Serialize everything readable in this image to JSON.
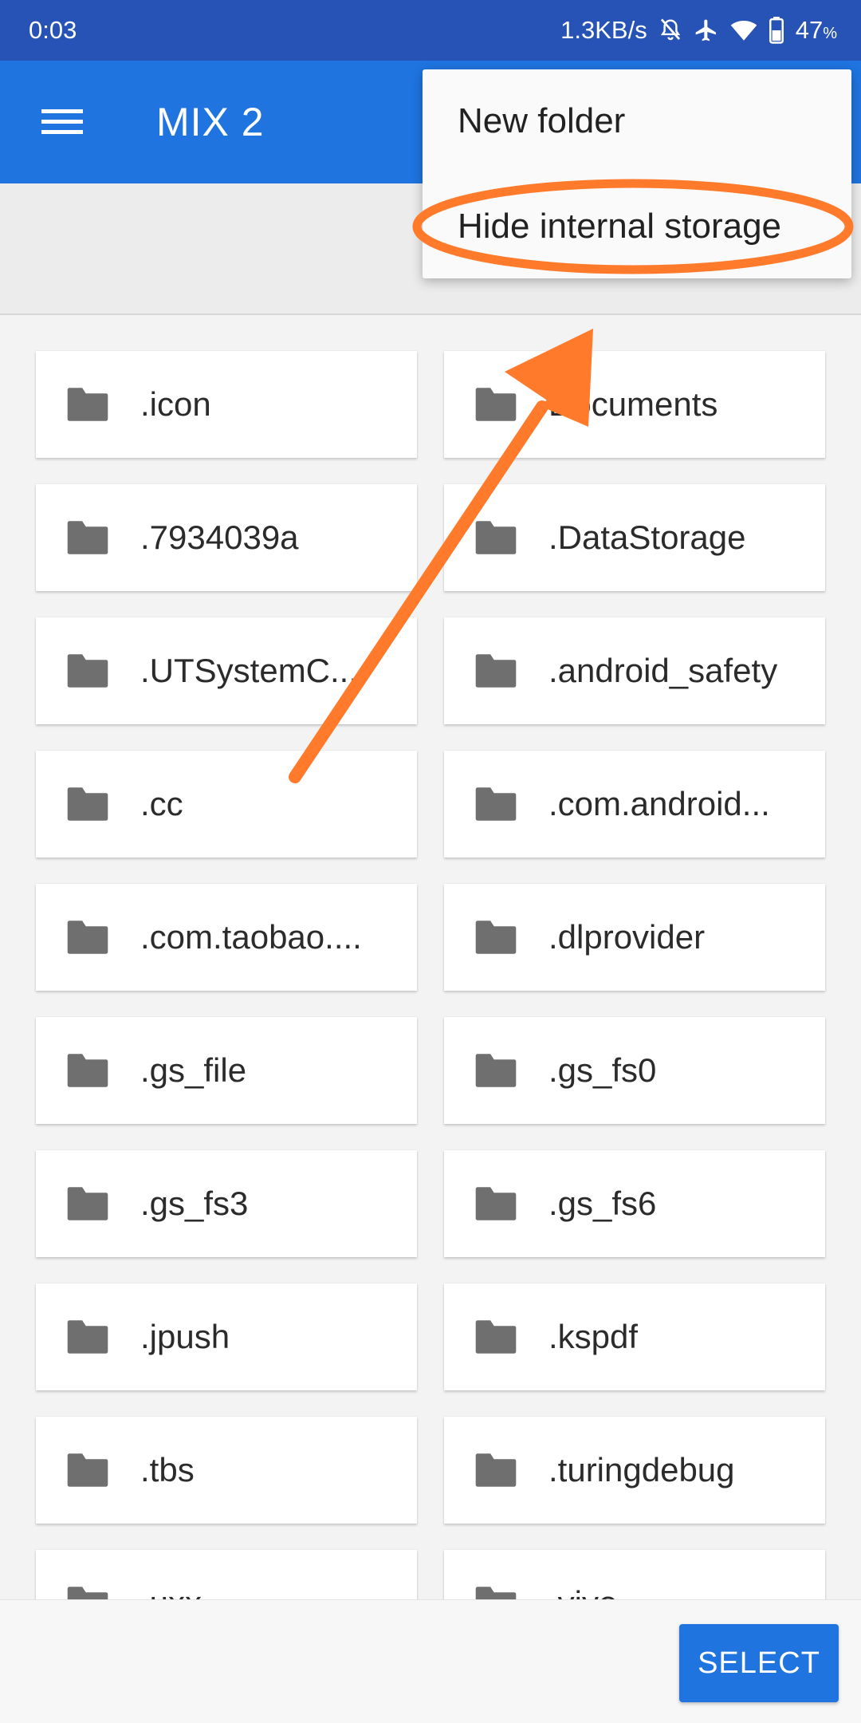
{
  "status_bar": {
    "time": "0:03",
    "net_speed": "1.3KB/s",
    "battery": "47",
    "battery_unit": "%",
    "icons": [
      "bell-off-icon",
      "airplane-icon",
      "wifi-icon",
      "battery-icon"
    ]
  },
  "app_bar": {
    "title": "MIX 2",
    "menu_icon": "hamburger-icon",
    "color": "#1f74e0"
  },
  "overflow_menu": {
    "items": [
      {
        "label": "New folder"
      },
      {
        "label": "Hide internal storage"
      }
    ]
  },
  "folders": [
    {
      "name": ".icon"
    },
    {
      "name": "Documents"
    },
    {
      "name": ".7934039a"
    },
    {
      "name": ".DataStorage"
    },
    {
      "name": ".UTSystemC..."
    },
    {
      "name": ".android_safety"
    },
    {
      "name": ".cc"
    },
    {
      "name": ".com.android..."
    },
    {
      "name": ".com.taobao...."
    },
    {
      "name": ".dlprovider"
    },
    {
      "name": ".gs_file"
    },
    {
      "name": ".gs_fs0"
    },
    {
      "name": ".gs_fs3"
    },
    {
      "name": ".gs_fs6"
    },
    {
      "name": ".jpush"
    },
    {
      "name": ".kspdf"
    },
    {
      "name": ".tbs"
    },
    {
      "name": ".turingdebug"
    },
    {
      "name": ".uxx"
    },
    {
      "name": ".vivo"
    }
  ],
  "bottom_bar": {
    "select_label": "SELECT"
  },
  "annotation": {
    "color": "#ff7a2a"
  }
}
